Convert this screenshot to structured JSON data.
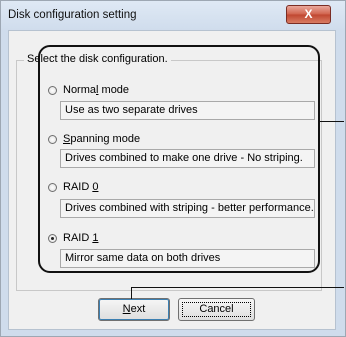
{
  "window": {
    "title": "Disk configuration setting",
    "close_glyph": "X"
  },
  "group": {
    "label": "Select the disk configuration."
  },
  "options": [
    {
      "pre": "Norma",
      "accel": "l",
      "post": " mode",
      "description": "Use as two separate drives",
      "selected": false
    },
    {
      "pre": "",
      "accel": "S",
      "post": "panning mode",
      "description": "Drives combined to make one drive - No striping.",
      "selected": false
    },
    {
      "pre": "RAID ",
      "accel": "0",
      "post": "",
      "description": "Drives combined with striping - better performance.",
      "selected": false
    },
    {
      "pre": "RAID ",
      "accel": "1",
      "post": "",
      "description": "Mirror same data on both drives",
      "selected": true
    }
  ],
  "buttons": {
    "next": {
      "accel": "N",
      "rest": "ext"
    },
    "cancel": {
      "label": "Cancel"
    }
  },
  "colors": {
    "close_button": "#c8533e",
    "frame": "#9da7b3",
    "client_bg": "#f0f0f0"
  }
}
